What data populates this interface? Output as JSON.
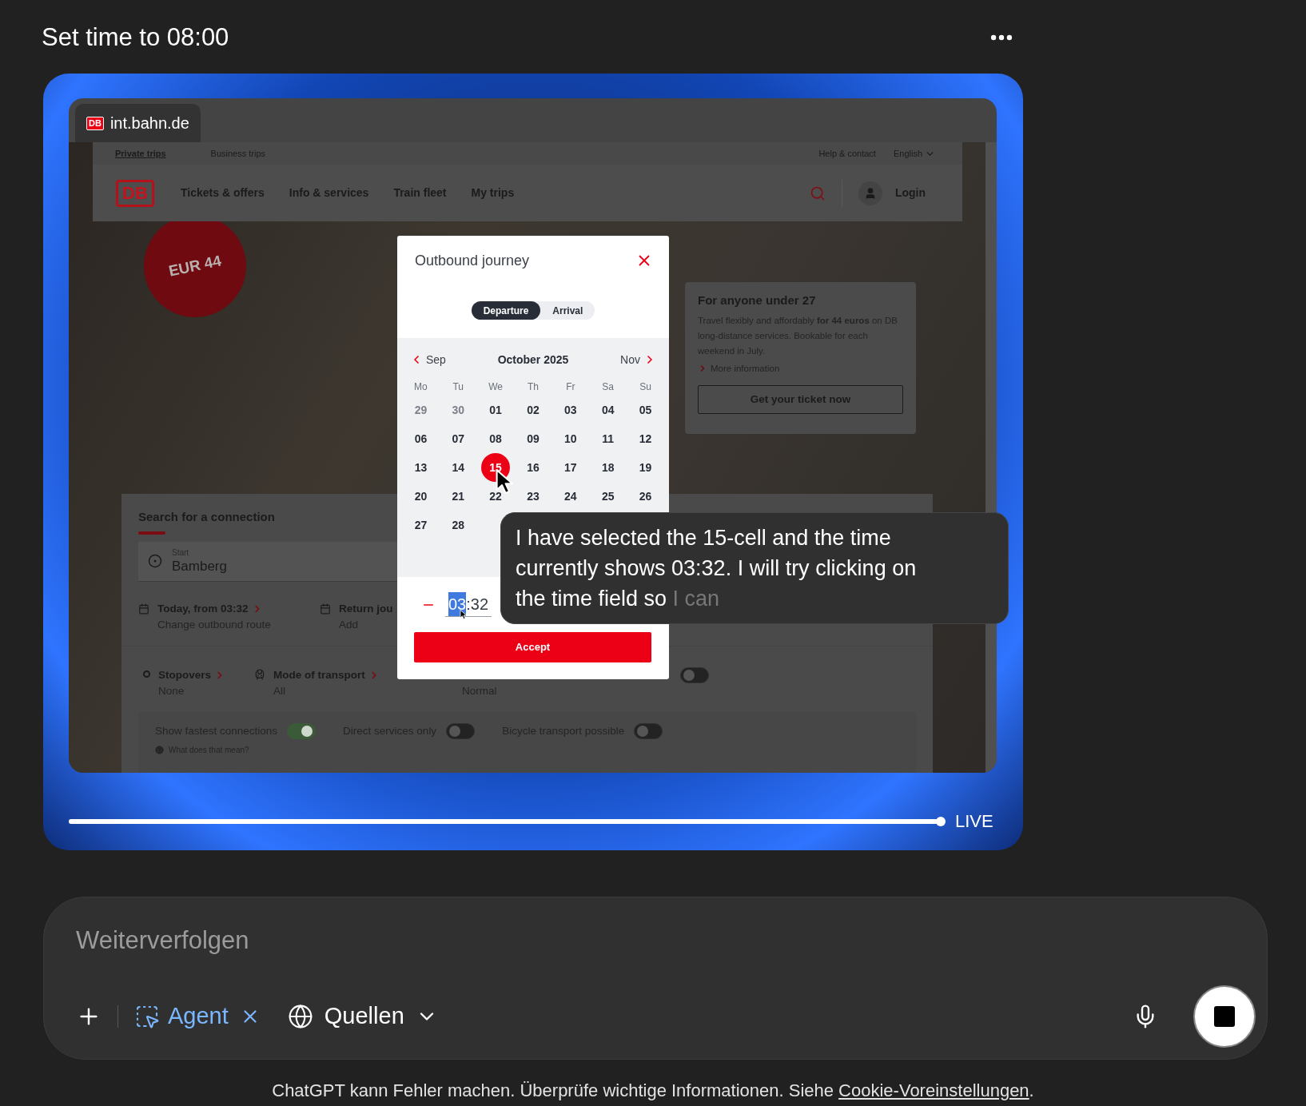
{
  "header": {
    "title": "Set time to 08:00"
  },
  "browser": {
    "tab": {
      "title": "int.bahn.de",
      "logo": "DB"
    },
    "page": {
      "topbar": {
        "left": [
          {
            "label": "Private trips",
            "selected": true
          },
          {
            "label": "Business trips",
            "selected": false
          }
        ],
        "right": [
          {
            "label": "Help & contact",
            "kind": "link"
          },
          {
            "label": "English",
            "kind": "menu"
          }
        ]
      },
      "nav": {
        "logo": "DB",
        "items": [
          "Tickets & offers",
          "Info & services",
          "Train fleet",
          "My trips"
        ],
        "login": "Login"
      },
      "badge": "EUR 44",
      "promo": {
        "title": "For anyone under 27",
        "text": "Travel flexibly and affordably **for 44 euros** on DB long-distance services. Bookable for each weekend in July.",
        "link": "More information",
        "button": "Get your ticket now"
      },
      "search": {
        "title": "Search for a connection",
        "start": {
          "label": "Start",
          "value": "Bamberg"
        },
        "dates": [
          {
            "title": "Today, from 03:32",
            "subtitle": "Change outbound route",
            "arrow": true
          },
          {
            "title": "Return jou",
            "subtitle": "Add",
            "arrow": false
          }
        ],
        "options": [
          {
            "kind": "stopovers",
            "title": "Stopovers",
            "value": "None"
          },
          {
            "kind": "transport",
            "title": "Mode of transport",
            "value": "All"
          },
          {
            "kind": "plain",
            "value": "Normal"
          }
        ],
        "extra_toggle": {
          "on": false
        },
        "toggles": [
          {
            "label": "Show fastest connections",
            "on": true
          },
          {
            "label": "Direct services only",
            "on": false
          },
          {
            "label": "Bicycle transport possible",
            "on": false
          }
        ],
        "help": "What does that mean?"
      }
    },
    "dialog": {
      "title": "Outbound journey",
      "modes": [
        {
          "label": "Departure",
          "selected": true
        },
        {
          "label": "Arrival",
          "selected": false
        }
      ],
      "prev": "Sep",
      "month": "October 2025",
      "next": "Nov",
      "weekdays": [
        "Mo",
        "Tu",
        "We",
        "Th",
        "Fr",
        "Sa",
        "Su"
      ],
      "weeks": [
        [
          {
            "day": "29",
            "outside": true,
            "selected": false
          },
          {
            "day": "30",
            "outside": true,
            "selected": false
          },
          {
            "day": "01",
            "outside": false,
            "selected": false
          },
          {
            "day": "02",
            "outside": false,
            "selected": false
          },
          {
            "day": "03",
            "outside": false,
            "selected": false
          },
          {
            "day": "04",
            "outside": false,
            "selected": false
          },
          {
            "day": "05",
            "outside": false,
            "selected": false
          }
        ],
        [
          {
            "day": "06",
            "outside": false,
            "selected": false
          },
          {
            "day": "07",
            "outside": false,
            "selected": false
          },
          {
            "day": "08",
            "outside": false,
            "selected": false
          },
          {
            "day": "09",
            "outside": false,
            "selected": false
          },
          {
            "day": "10",
            "outside": false,
            "selected": false
          },
          {
            "day": "11",
            "outside": false,
            "selected": false
          },
          {
            "day": "12",
            "outside": false,
            "selected": false
          }
        ],
        [
          {
            "day": "13",
            "outside": false,
            "selected": false
          },
          {
            "day": "14",
            "outside": false,
            "selected": false
          },
          {
            "day": "15",
            "outside": false,
            "selected": true
          },
          {
            "day": "16",
            "outside": false,
            "selected": false
          },
          {
            "day": "17",
            "outside": false,
            "selected": false
          },
          {
            "day": "18",
            "outside": false,
            "selected": false
          },
          {
            "day": "19",
            "outside": false,
            "selected": false
          }
        ],
        [
          {
            "day": "20",
            "outside": false,
            "selected": false
          },
          {
            "day": "21",
            "outside": false,
            "selected": false
          },
          {
            "day": "22",
            "outside": false,
            "selected": false
          },
          {
            "day": "23",
            "outside": false,
            "selected": false
          },
          {
            "day": "24",
            "outside": false,
            "selected": false
          },
          {
            "day": "25",
            "outside": false,
            "selected": false
          },
          {
            "day": "26",
            "outside": false,
            "selected": false
          }
        ],
        [
          {
            "day": "27",
            "outside": false,
            "selected": false
          },
          {
            "day": "28",
            "outside": false,
            "selected": false
          }
        ]
      ],
      "time": {
        "parts": [
          {
            "text": "03",
            "highlighted": true
          },
          {
            "text": ":32",
            "highlighted": false
          }
        ]
      },
      "accept": "Accept"
    }
  },
  "message": {
    "text": "I have selected the 15-cell and the time currently shows 03:32. I will try clicking on the time field so ",
    "pending": "I can"
  },
  "player": {
    "level": 1,
    "label": "LIVE"
  },
  "composer": {
    "placeholder": "Weiterverfolgen",
    "agent": "Agent",
    "sources": "Quellen"
  },
  "footer": {
    "text": "ChatGPT kann Fehler machen. Überprüfe wichtige Informationen. Siehe ",
    "link": "Cookie-Voreinstellungen",
    "after": "."
  }
}
